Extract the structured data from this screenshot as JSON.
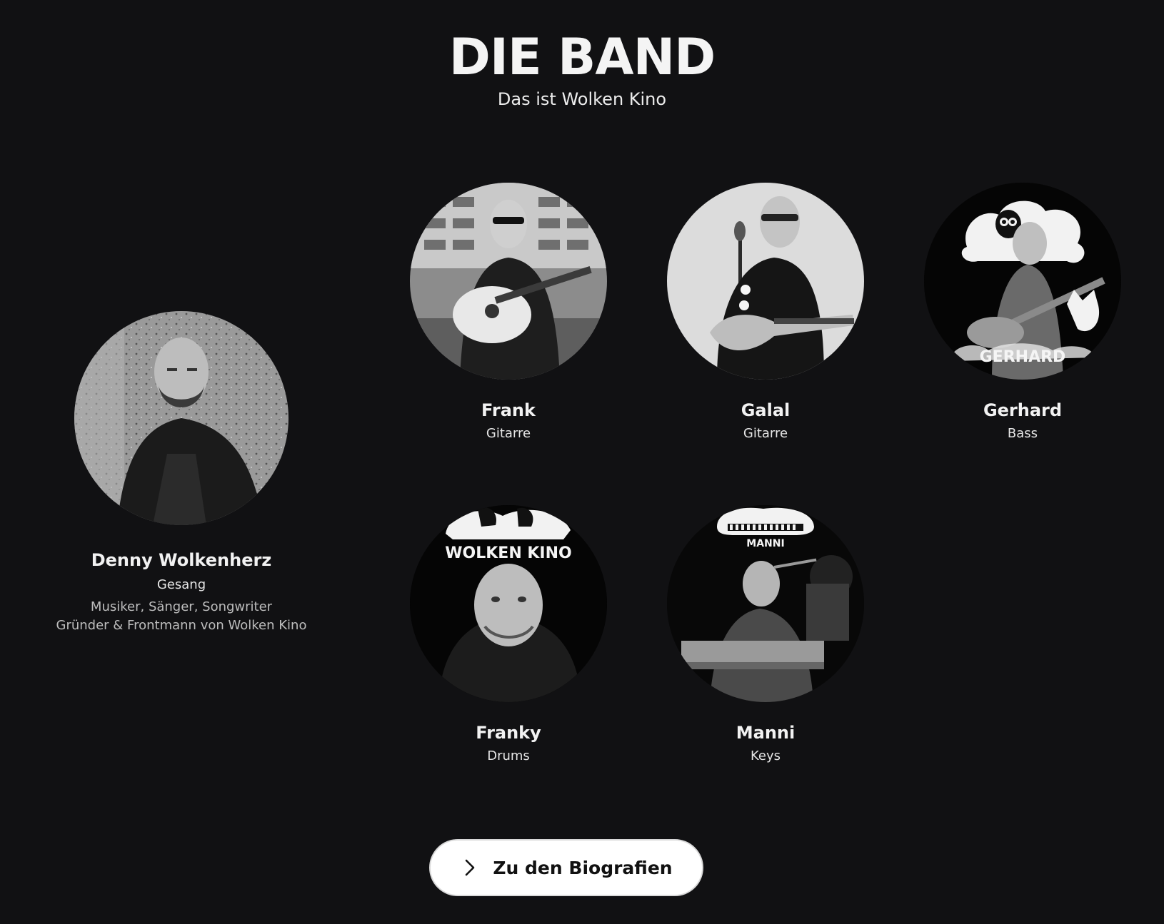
{
  "header": {
    "title": "DIE BAND",
    "subtitle": "Das ist Wolken Kino"
  },
  "members": {
    "denny": {
      "name": "Denny Wolkenherz",
      "role": "Gesang",
      "desc_line1": "Musiker, Sänger, Songwriter",
      "desc_line2": "Gründer & Frontmann von Wolken Kino"
    },
    "frank": {
      "name": "Frank",
      "role": "Gitarre"
    },
    "galal": {
      "name": "Galal",
      "role": "Gitarre"
    },
    "gerhard": {
      "name": "Gerhard",
      "role": "Bass",
      "badge": "GERHARD"
    },
    "franky": {
      "name": "Franky",
      "role": "Drums",
      "badge": "WOLKEN KINO"
    },
    "manni": {
      "name": "Manni",
      "role": "Keys",
      "badge": "MANNI"
    }
  },
  "cta": {
    "label": "Zu den Biografien",
    "icon": "chevron-right-icon"
  },
  "colors": {
    "background": "#111113",
    "text": "#f2f2f2",
    "button_bg": "#ffffff",
    "button_text": "#111111"
  }
}
